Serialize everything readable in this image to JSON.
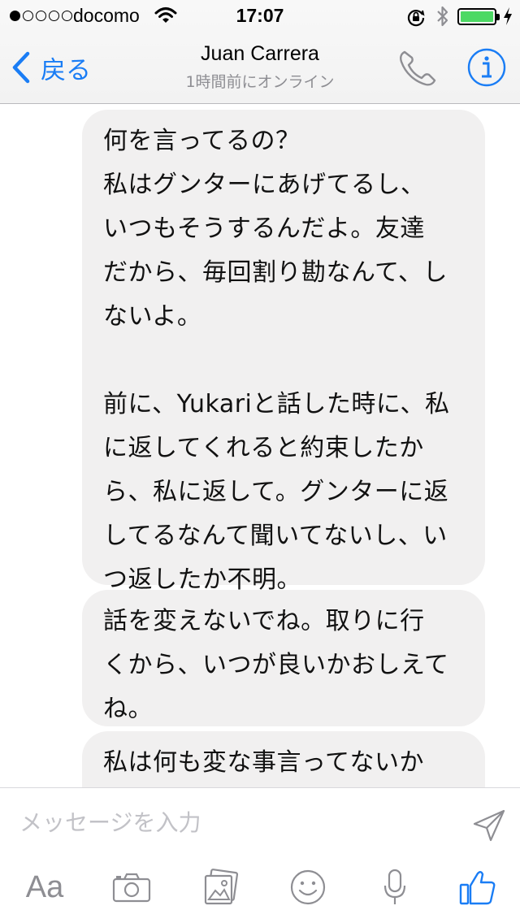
{
  "status_bar": {
    "carrier": "docomo",
    "time": "17:07",
    "signal_strength": 1,
    "battery_color": "#4cd964"
  },
  "nav": {
    "back_label": "戻る",
    "title": "Juan Carrera",
    "subtitle": "1時間前にオンライン",
    "accent_color": "#1a7df5"
  },
  "messages": [
    {
      "text": "何を言ってるの？\n私はグンターにあげてるし、\nいつもそうするんだよ。友達\nだから、毎回割り勘なんて、し\nないよ。\n\n前に、Yukariと話した時に、私\nに返してくれると約束したか\nら、私に返して。グンターに返\nしてるなんて聞いてないし、い\nつ返したか不明。"
    },
    {
      "text": "話を変えないでね。取りに行\nくから、いつが良いかおしえて\nね。"
    },
    {
      "text": "私は何も変な事言ってないか\nら。前に話した時に約束したじ"
    }
  ],
  "composer": {
    "placeholder": "メッセージを入力",
    "value": "",
    "tools": [
      {
        "label": "Aa",
        "icon": "text-format-icon"
      },
      {
        "icon": "camera-icon"
      },
      {
        "icon": "photo-gallery-icon"
      },
      {
        "icon": "emoji-icon"
      },
      {
        "icon": "microphone-icon"
      },
      {
        "icon": "like-icon"
      }
    ]
  }
}
